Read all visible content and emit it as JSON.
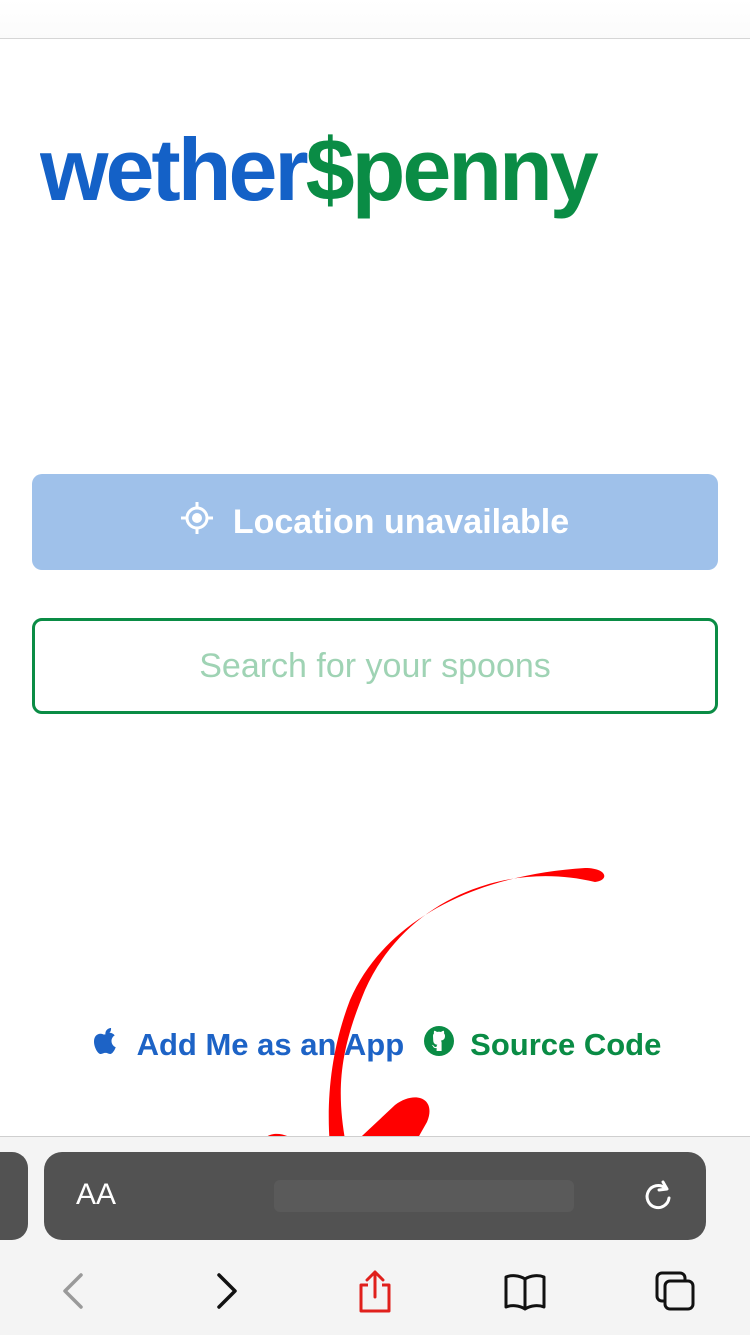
{
  "brand": {
    "part1": "wether",
    "dollar": "$",
    "part2": "penny",
    "blue": "#1461c7",
    "green": "#0a8c45"
  },
  "location": {
    "label": "Location unavailable",
    "icon": "location-crosshair-icon"
  },
  "search": {
    "placeholder": "Search for your spoons",
    "value": ""
  },
  "links": {
    "add_app": {
      "label": "Add Me as an App",
      "icon": "apple-icon"
    },
    "source": {
      "label": "Source Code",
      "icon": "github-icon"
    }
  },
  "browser": {
    "text_size_label": "AA",
    "toolbar": [
      "back-icon",
      "forward-icon",
      "share-icon",
      "bookmarks-icon",
      "tabs-icon"
    ]
  },
  "colors": {
    "button_blue": "#9fc1ea",
    "border_green": "#0a8c45",
    "annotation_red": "#ff0000"
  }
}
